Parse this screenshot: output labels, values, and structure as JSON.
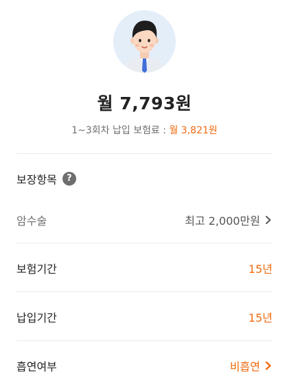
{
  "monthly_price": "월 7,793원",
  "sub_info": {
    "prefix": "1~3회차 납입 보험료 : ",
    "value": "월 3,821원"
  },
  "coverage": {
    "title": "보장항목",
    "help_icon": "question-circle-icon",
    "item_label": "암수술",
    "item_value": "최고 2,000만원"
  },
  "rows": [
    {
      "label": "보험기간",
      "value": "15년"
    },
    {
      "label": "납입기간",
      "value": "15년"
    },
    {
      "label": "흡연여부",
      "value": "비흡연"
    }
  ],
  "colors": {
    "accent": "#f26a0f",
    "muted": "#6f6f6f",
    "avatar_bg": "#e3eef9"
  }
}
